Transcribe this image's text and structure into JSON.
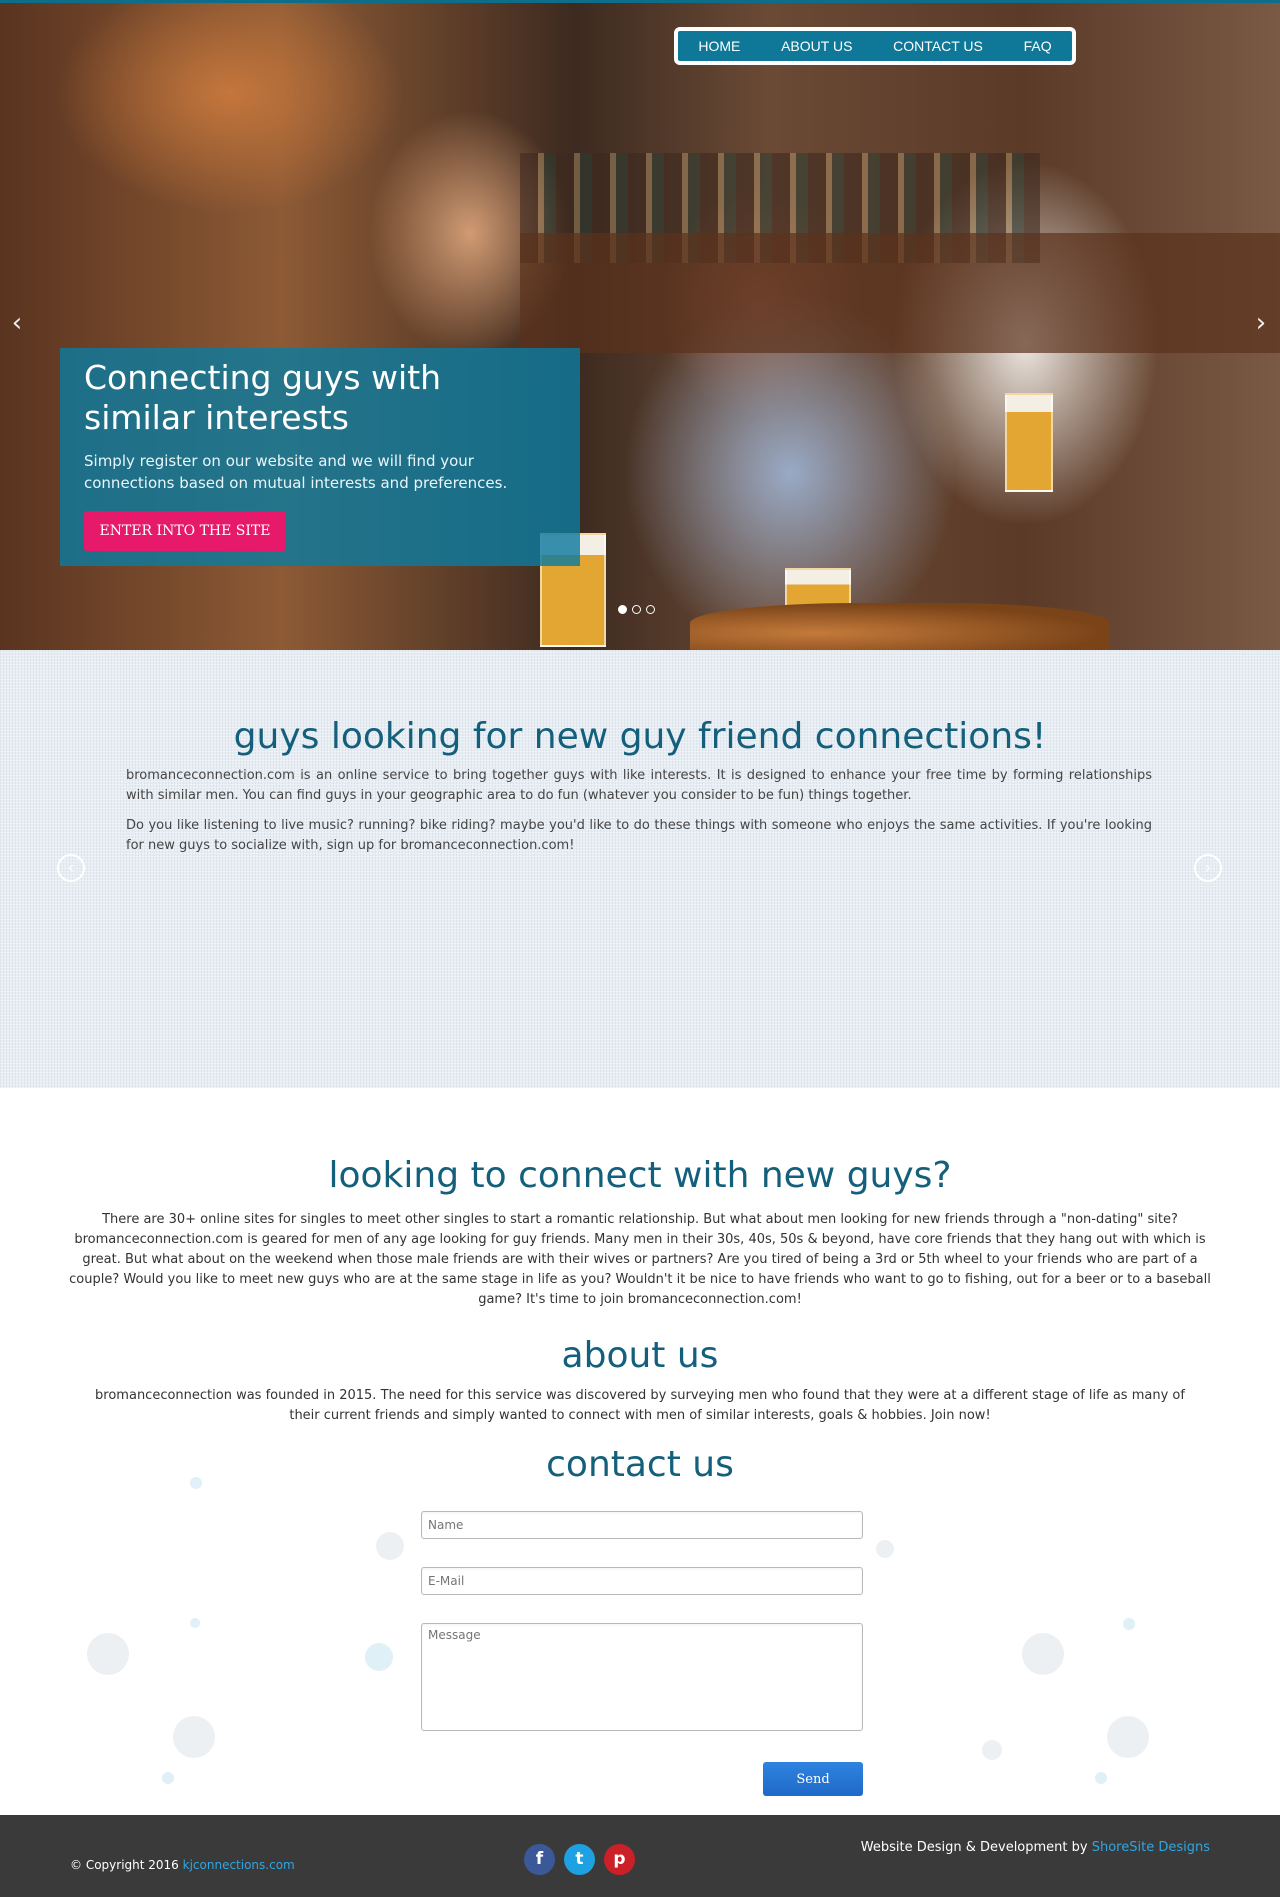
{
  "nav": {
    "items": [
      "HOME",
      "ABOUT US",
      "CONTACT US",
      "FAQ"
    ]
  },
  "hero": {
    "title": "Connecting guys with similar interests",
    "subtitle": "Simply register on our website and we will find your connections based on mutual interests and preferences.",
    "cta": "ENTER INTO THE SITE",
    "arrow_left": "‹",
    "arrow_right": "›",
    "slide_count": 3,
    "active_slide": 1
  },
  "intro": {
    "title": "guys looking for new guy friend connections!",
    "para1": "bromanceconnection.com is an online service to bring together guys with like interests. It is designed to enhance your free time by forming relationships with similar men. You can find guys in your geographic area to do fun (whatever you consider to be fun) things together.",
    "para2": "Do you like listening to live music? running? bike riding? maybe you'd like to do these things with someone who enjoys the same activities. If you're looking for new guys to socialize with, sign up for bromanceconnection.com!",
    "prev": "‹",
    "next": "›"
  },
  "connect": {
    "title": "looking to connect with new guys?",
    "text": "There are 30+ online sites for singles to meet other singles to start a romantic relationship. But what about men looking for new friends through a \"non-dating\" site? bromanceconnection.com is geared for men of any age looking for guy friends. Many men in their 30s, 40s, 50s & beyond, have core friends that they hang out with which is great. But what about on the weekend when those male friends are with their wives or partners? Are you tired of being a 3rd or 5th wheel to your friends who are part of a couple? Would you like to meet new guys who are at the same stage in life as you? Wouldn't it be nice to have friends who want to go to fishing, out for a beer or to a baseball game? It's time to join bromanceconnection.com!"
  },
  "about": {
    "title": "about us",
    "text": "bromanceconnection was founded in 2015. The need for this service was discovered by surveying men who found that they were at a different stage of life as many of their current friends and simply wanted to connect with men of similar interests, goals & hobbies. Join now!"
  },
  "contact": {
    "title": "contact us",
    "name_placeholder": "Name",
    "email_placeholder": "E-Mail",
    "message_placeholder": "Message",
    "send_label": "Send"
  },
  "footer": {
    "copyright_prefix": "© Copyright 2016",
    "copyright_link": "kjconnections.com",
    "credit_prefix": "Website Design & Development by",
    "credit_link": "ShoreSite Designs",
    "social": [
      {
        "icon": "facebook-icon",
        "glyph": "f",
        "color": "#3b5998"
      },
      {
        "icon": "twitter-icon",
        "glyph": "t",
        "color": "#1da1e2"
      },
      {
        "icon": "pinterest-icon",
        "glyph": "p",
        "color": "#cb2027"
      }
    ]
  },
  "colors": {
    "brand": "#0f7898",
    "heading": "#14607c",
    "cta": "#e6196a",
    "send": "#2677d6",
    "footer": "#3a3a3a"
  }
}
